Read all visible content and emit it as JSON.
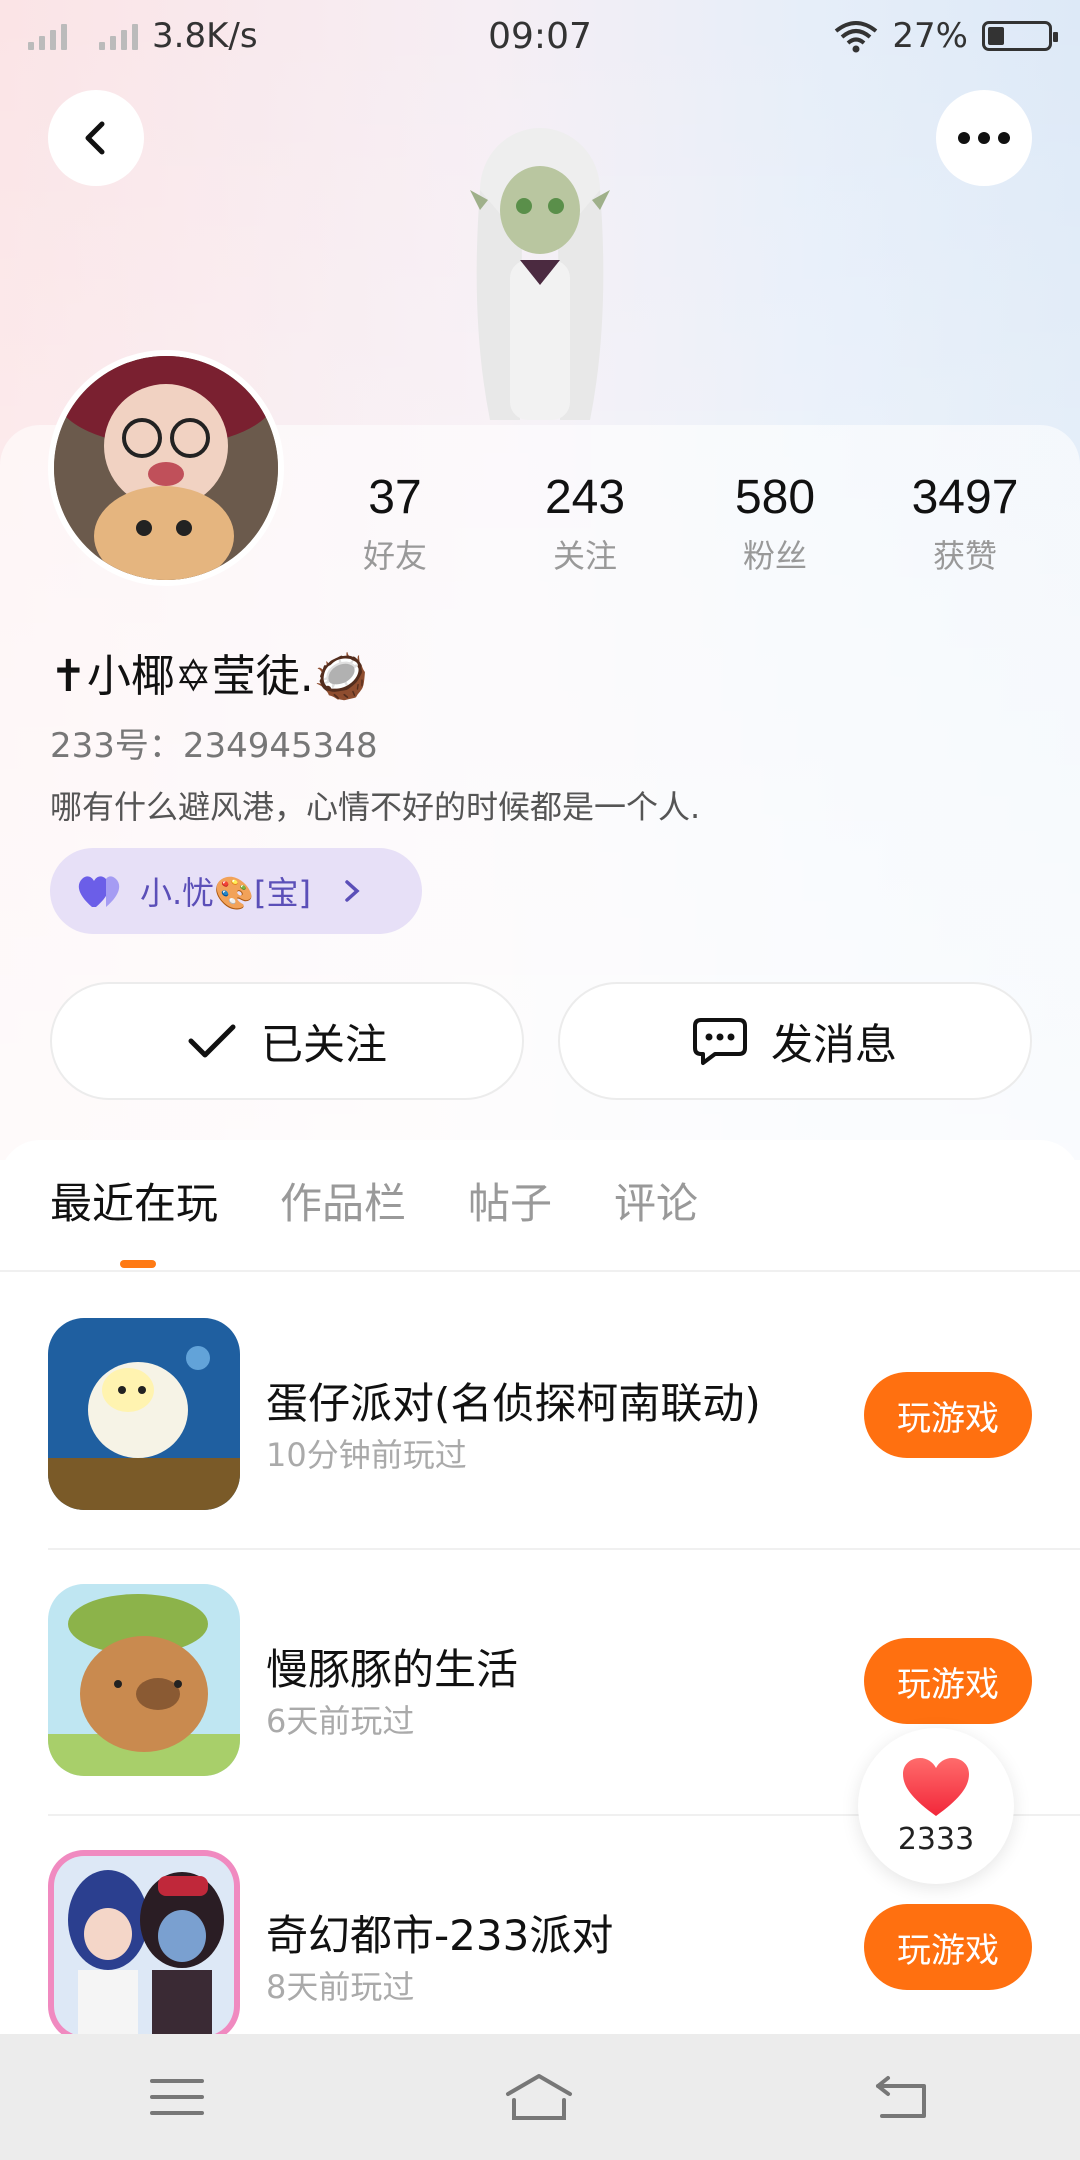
{
  "status_bar": {
    "net_speed": "3.8K/s",
    "time": "09:07",
    "battery": "27%",
    "battery_level": 0.27
  },
  "profile": {
    "stats": [
      {
        "value": "37",
        "label": "好友"
      },
      {
        "value": "243",
        "label": "关注"
      },
      {
        "value": "580",
        "label": "粉丝"
      },
      {
        "value": "3497",
        "label": "获赞"
      }
    ],
    "name": "✝小椰✡莹徒.🥥",
    "uid": "233号：234945348",
    "bio": "哪有什么避风港，心情不好的时候都是一个人.",
    "cp_badge": "小.忧🎨[宝]",
    "follow_label": "已关注",
    "message_label": "发消息"
  },
  "tabs": [
    {
      "label": "最近在玩",
      "active": true
    },
    {
      "label": "作品栏",
      "active": false
    },
    {
      "label": "帖子",
      "active": false
    },
    {
      "label": "评论",
      "active": false
    }
  ],
  "games": [
    {
      "title": "蛋仔派对(名侦探柯南联动)",
      "time": "10分钟前玩过",
      "button": "玩游戏"
    },
    {
      "title": "慢豚豚的生活",
      "time": "6天前玩过",
      "button": "玩游戏"
    },
    {
      "title": "奇幻都市-233派对",
      "time": "8天前玩过",
      "button": "玩游戏"
    }
  ],
  "like_float": {
    "count": "2333"
  },
  "colors": {
    "accent": "#ff7010",
    "badge_bg": "#e7e0f7",
    "badge_text": "#5b4fb8"
  }
}
